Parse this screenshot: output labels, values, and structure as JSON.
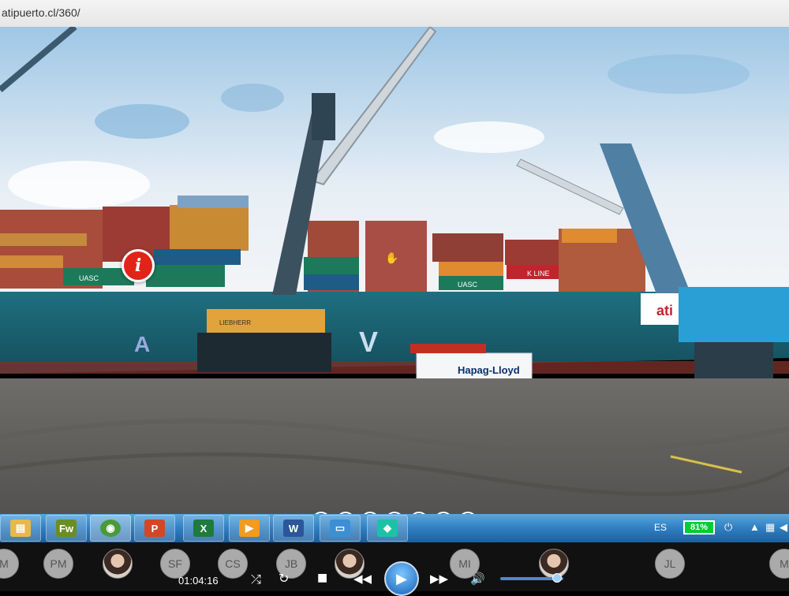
{
  "browser": {
    "url": "atipuerto.cl/360/"
  },
  "panorama": {
    "ship_letters": [
      "A",
      "V"
    ],
    "container_brand": "UASC",
    "container_brand_2": "K LINE",
    "mobile_crane_brand": "LIEBHERR",
    "reefer_brand": "Hapag-Lloyd",
    "crane_logo": "ati",
    "info_hotspot_glyph": "i",
    "controls": [
      {
        "name": "rotate-left",
        "glyph": "«"
      },
      {
        "name": "rotate-right",
        "glyph": "»"
      },
      {
        "name": "up",
        "glyph": "↑"
      },
      {
        "name": "down",
        "glyph": "↓"
      },
      {
        "name": "zoom-out",
        "glyph": "⇦"
      },
      {
        "name": "zoom-in",
        "glyph": "⇨"
      },
      {
        "name": "hide",
        "glyph": "⊘"
      }
    ]
  },
  "taskbar": {
    "apps": [
      {
        "name": "explorer",
        "glyph": "▤",
        "color": "#e8b84a"
      },
      {
        "name": "fireworks",
        "glyph": "Fw",
        "color": "#6b8e23"
      },
      {
        "name": "chrome",
        "glyph": "◉",
        "color": "#4a9a3a"
      },
      {
        "name": "powerpoint",
        "glyph": "P",
        "color": "#d24726"
      },
      {
        "name": "excel",
        "glyph": "X",
        "color": "#1f7a3f"
      },
      {
        "name": "media-player",
        "glyph": "▶",
        "color": "#f29b1e"
      },
      {
        "name": "word",
        "glyph": "W",
        "color": "#2b579a"
      },
      {
        "name": "photos",
        "glyph": "▭",
        "color": "#3c8fd4"
      },
      {
        "name": "filmora",
        "glyph": "◆",
        "color": "#1bc2a6"
      }
    ],
    "language": "ES",
    "battery": "81%"
  },
  "call": {
    "participants": [
      "M",
      "PM",
      "",
      "SF",
      "CS",
      "JB",
      "",
      "",
      "MI",
      "",
      "JL",
      "M"
    ],
    "time": "01:04:16"
  }
}
